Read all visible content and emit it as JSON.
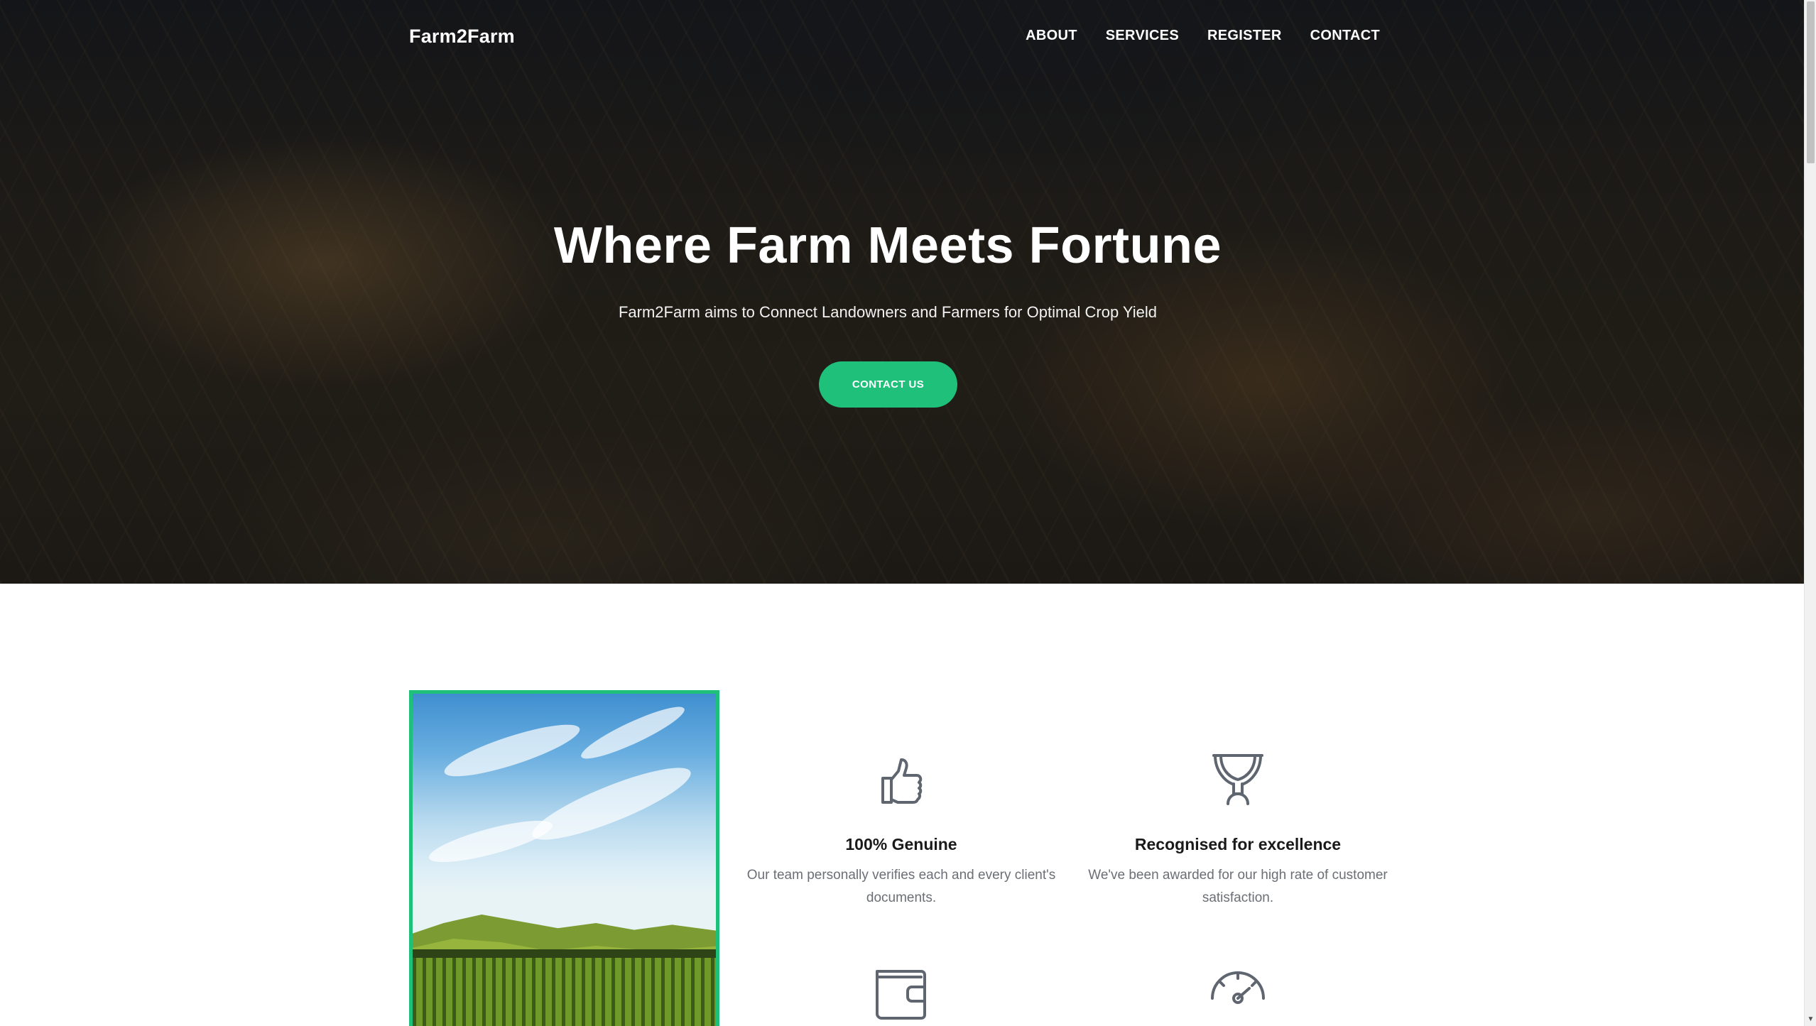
{
  "nav": {
    "brand": "Farm2Farm",
    "links": [
      "ABOUT",
      "SERVICES",
      "REGISTER",
      "CONTACT"
    ]
  },
  "hero": {
    "title": "Where Farm Meets Fortune",
    "subtitle": "Farm2Farm aims to Connect Landowners and Farmers for Optimal Crop Yield",
    "button_label": "CONTACT US"
  },
  "features": [
    {
      "icon": "thumbs-up-icon",
      "title": "100% Genuine",
      "description": "Our team personally verifies each and every client's documents."
    },
    {
      "icon": "trophy-icon",
      "title": "Recognised for excellence",
      "description": "We've been awarded for our high rate of customer satisfaction."
    },
    {
      "icon": "wallet-icon",
      "title": "",
      "description": ""
    },
    {
      "icon": "speedometer-icon",
      "title": "",
      "description": ""
    }
  ],
  "colors": {
    "accent": "#1fc07a",
    "muted_text": "#6b6f75",
    "icon_stroke": "#5f6670"
  }
}
